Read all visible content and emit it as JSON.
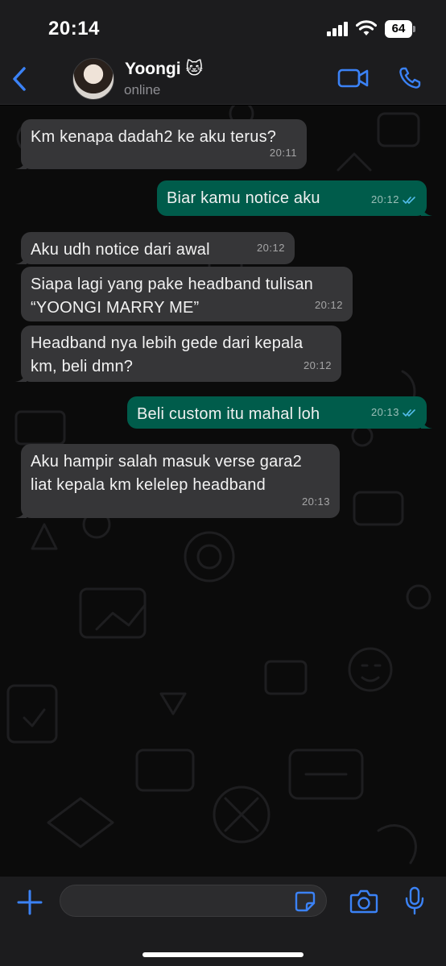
{
  "status_bar": {
    "time": "20:14",
    "battery": "64"
  },
  "header": {
    "contact_name": "Yoongi 🐱",
    "contact_status": "online"
  },
  "messages": [
    {
      "direction": "in",
      "text": "Km kenapa dadah2 ke aku terus?",
      "time": "20:11"
    },
    {
      "direction": "out",
      "text": "Biar kamu notice aku",
      "time": "20:12",
      "read": true
    },
    {
      "direction": "in",
      "text": "Aku udh notice dari awal",
      "time": "20:12"
    },
    {
      "direction": "in",
      "text": "Siapa lagi yang pake headband tulisan\n“YOONGI MARRY ME”",
      "time": "20:12"
    },
    {
      "direction": "in",
      "text": "Headband nya lebih gede dari kepala\nkm, beli dmn?",
      "time": "20:12"
    },
    {
      "direction": "out",
      "text": "Beli custom itu mahal loh",
      "time": "20:13",
      "read": true
    },
    {
      "direction": "in",
      "text": "Aku hampir salah masuk verse gara2\nliat kepala km kelelep headband",
      "time": "20:13"
    }
  ],
  "composer": {
    "value": "",
    "placeholder": ""
  },
  "colors": {
    "accent": "#3b82f6",
    "incoming_bubble": "#363638",
    "outgoing_bubble": "#005c4b",
    "read_ticks": "#53bdeb"
  }
}
